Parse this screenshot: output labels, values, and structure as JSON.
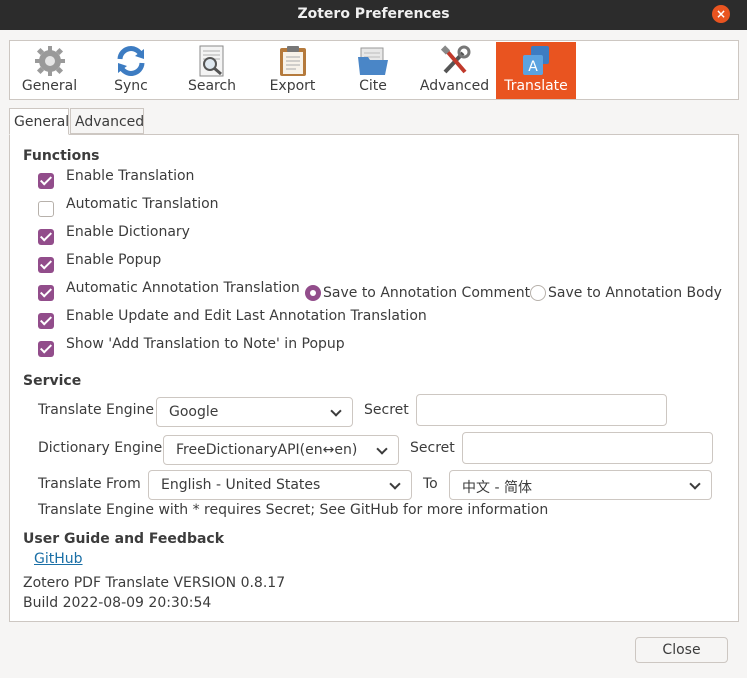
{
  "window": {
    "title": "Zotero Preferences"
  },
  "panes": [
    {
      "label": "General",
      "icon": "gear-icon"
    },
    {
      "label": "Sync",
      "icon": "sync-icon"
    },
    {
      "label": "Search",
      "icon": "search-document-icon"
    },
    {
      "label": "Export",
      "icon": "clipboard-icon"
    },
    {
      "label": "Cite",
      "icon": "folder-icon"
    },
    {
      "label": "Advanced",
      "icon": "tools-icon"
    },
    {
      "label": "Translate",
      "icon": "translate-icon",
      "selected": true
    }
  ],
  "subtabs": [
    {
      "label": "General",
      "active": true
    },
    {
      "label": "Advanced",
      "active": false
    }
  ],
  "functions": {
    "heading": "Functions",
    "items": [
      {
        "label": "Enable Translation",
        "checked": true
      },
      {
        "label": "Automatic Translation",
        "checked": false
      },
      {
        "label": "Enable Dictionary",
        "checked": true
      },
      {
        "label": "Enable Popup",
        "checked": true
      },
      {
        "label": "Automatic Annotation Translation",
        "checked": true
      },
      {
        "label": "Enable Update and Edit Last Annotation Translation",
        "checked": true
      },
      {
        "label": "Show 'Add Translation to Note' in Popup",
        "checked": true
      }
    ],
    "radios": [
      {
        "label": "Save to Annotation Comment",
        "selected": true
      },
      {
        "label": "Save to Annotation Body",
        "selected": false
      }
    ]
  },
  "service": {
    "heading": "Service",
    "translate_engine_label": "Translate Engine",
    "translate_engine_value": "Google",
    "secret_label": "Secret",
    "secret_value": "",
    "dictionary_engine_label": "Dictionary Engine",
    "dictionary_engine_value": "FreeDictionaryAPI(en↔en)",
    "dictionary_secret_label": "Secret",
    "dictionary_secret_value": "",
    "translate_from_label": "Translate From",
    "translate_from_value": "English - United States",
    "to_label": "To",
    "to_value": "中文 - 简体",
    "note": "Translate Engine with * requires Secret; See GitHub for more information"
  },
  "guide": {
    "heading": "User Guide and Feedback",
    "link": "GitHub",
    "version": "Zotero PDF Translate VERSION 0.8.17",
    "build": "Build 2022-08-09 20:30:54"
  },
  "footer": {
    "close_label": "Close"
  },
  "colors": {
    "accent": "#e95420",
    "checkbox": "#924d8b",
    "link": "#1a6fa6"
  }
}
